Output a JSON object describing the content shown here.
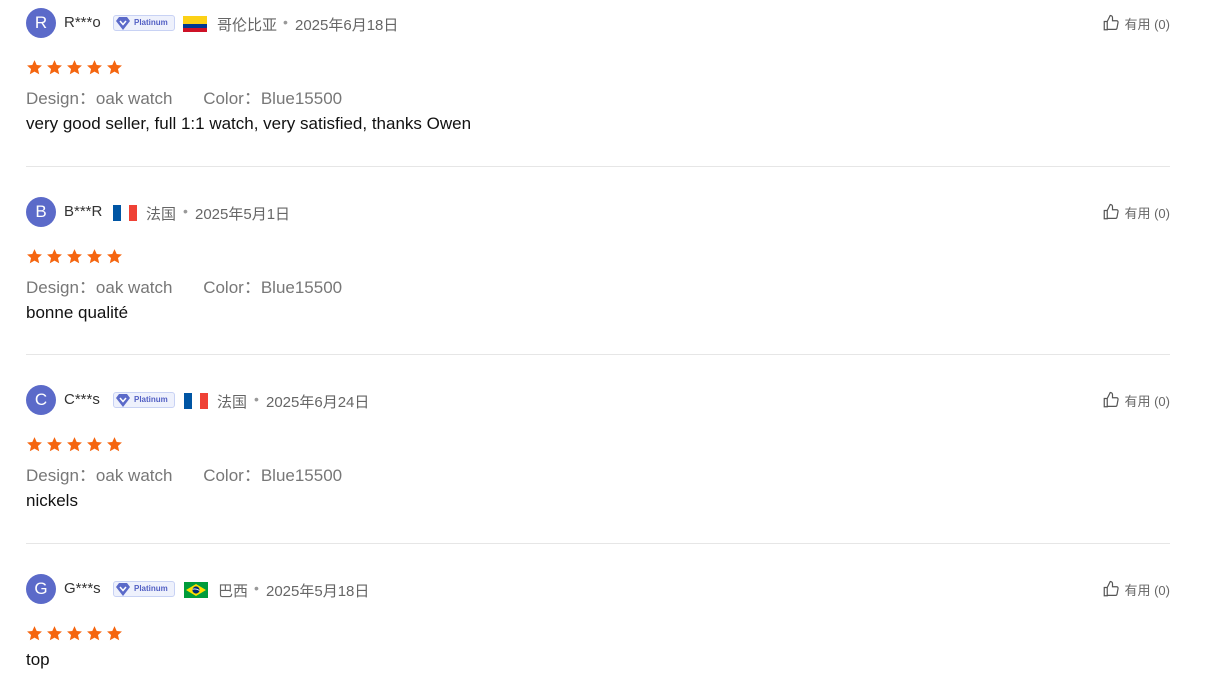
{
  "helpful_label": "有用 (0)",
  "star_color": "#f5650f",
  "avatar_color": "#5b6ac9",
  "attr_labels": {
    "design": "Design：",
    "color": "Color："
  },
  "reviews": [
    {
      "initial": "R",
      "name": "R***o",
      "badge": "Platinum",
      "flag": "colombia",
      "country": "哥伦比亚",
      "date": "2025年6月18日",
      "rating": 5,
      "design": "oak watch",
      "color": "Blue15500",
      "text": "very good seller, full 1:1 watch, very satisfied, thanks Owen"
    },
    {
      "initial": "B",
      "name": "B***R",
      "badge": "",
      "flag": "france",
      "country": "法国",
      "date": "2025年5月1日",
      "rating": 5,
      "design": "oak watch",
      "color": "Blue15500",
      "text": "bonne qualité"
    },
    {
      "initial": "C",
      "name": "C***s",
      "badge": "Platinum",
      "flag": "france",
      "country": "法国",
      "date": "2025年6月24日",
      "rating": 5,
      "design": "oak watch",
      "color": "Blue15500",
      "text": "nickels"
    },
    {
      "initial": "G",
      "name": "G***s",
      "badge": "Platinum",
      "flag": "brazil",
      "country": "巴西",
      "date": "2025年5月18日",
      "rating": 5,
      "design": "",
      "color": "",
      "text": "top"
    }
  ]
}
